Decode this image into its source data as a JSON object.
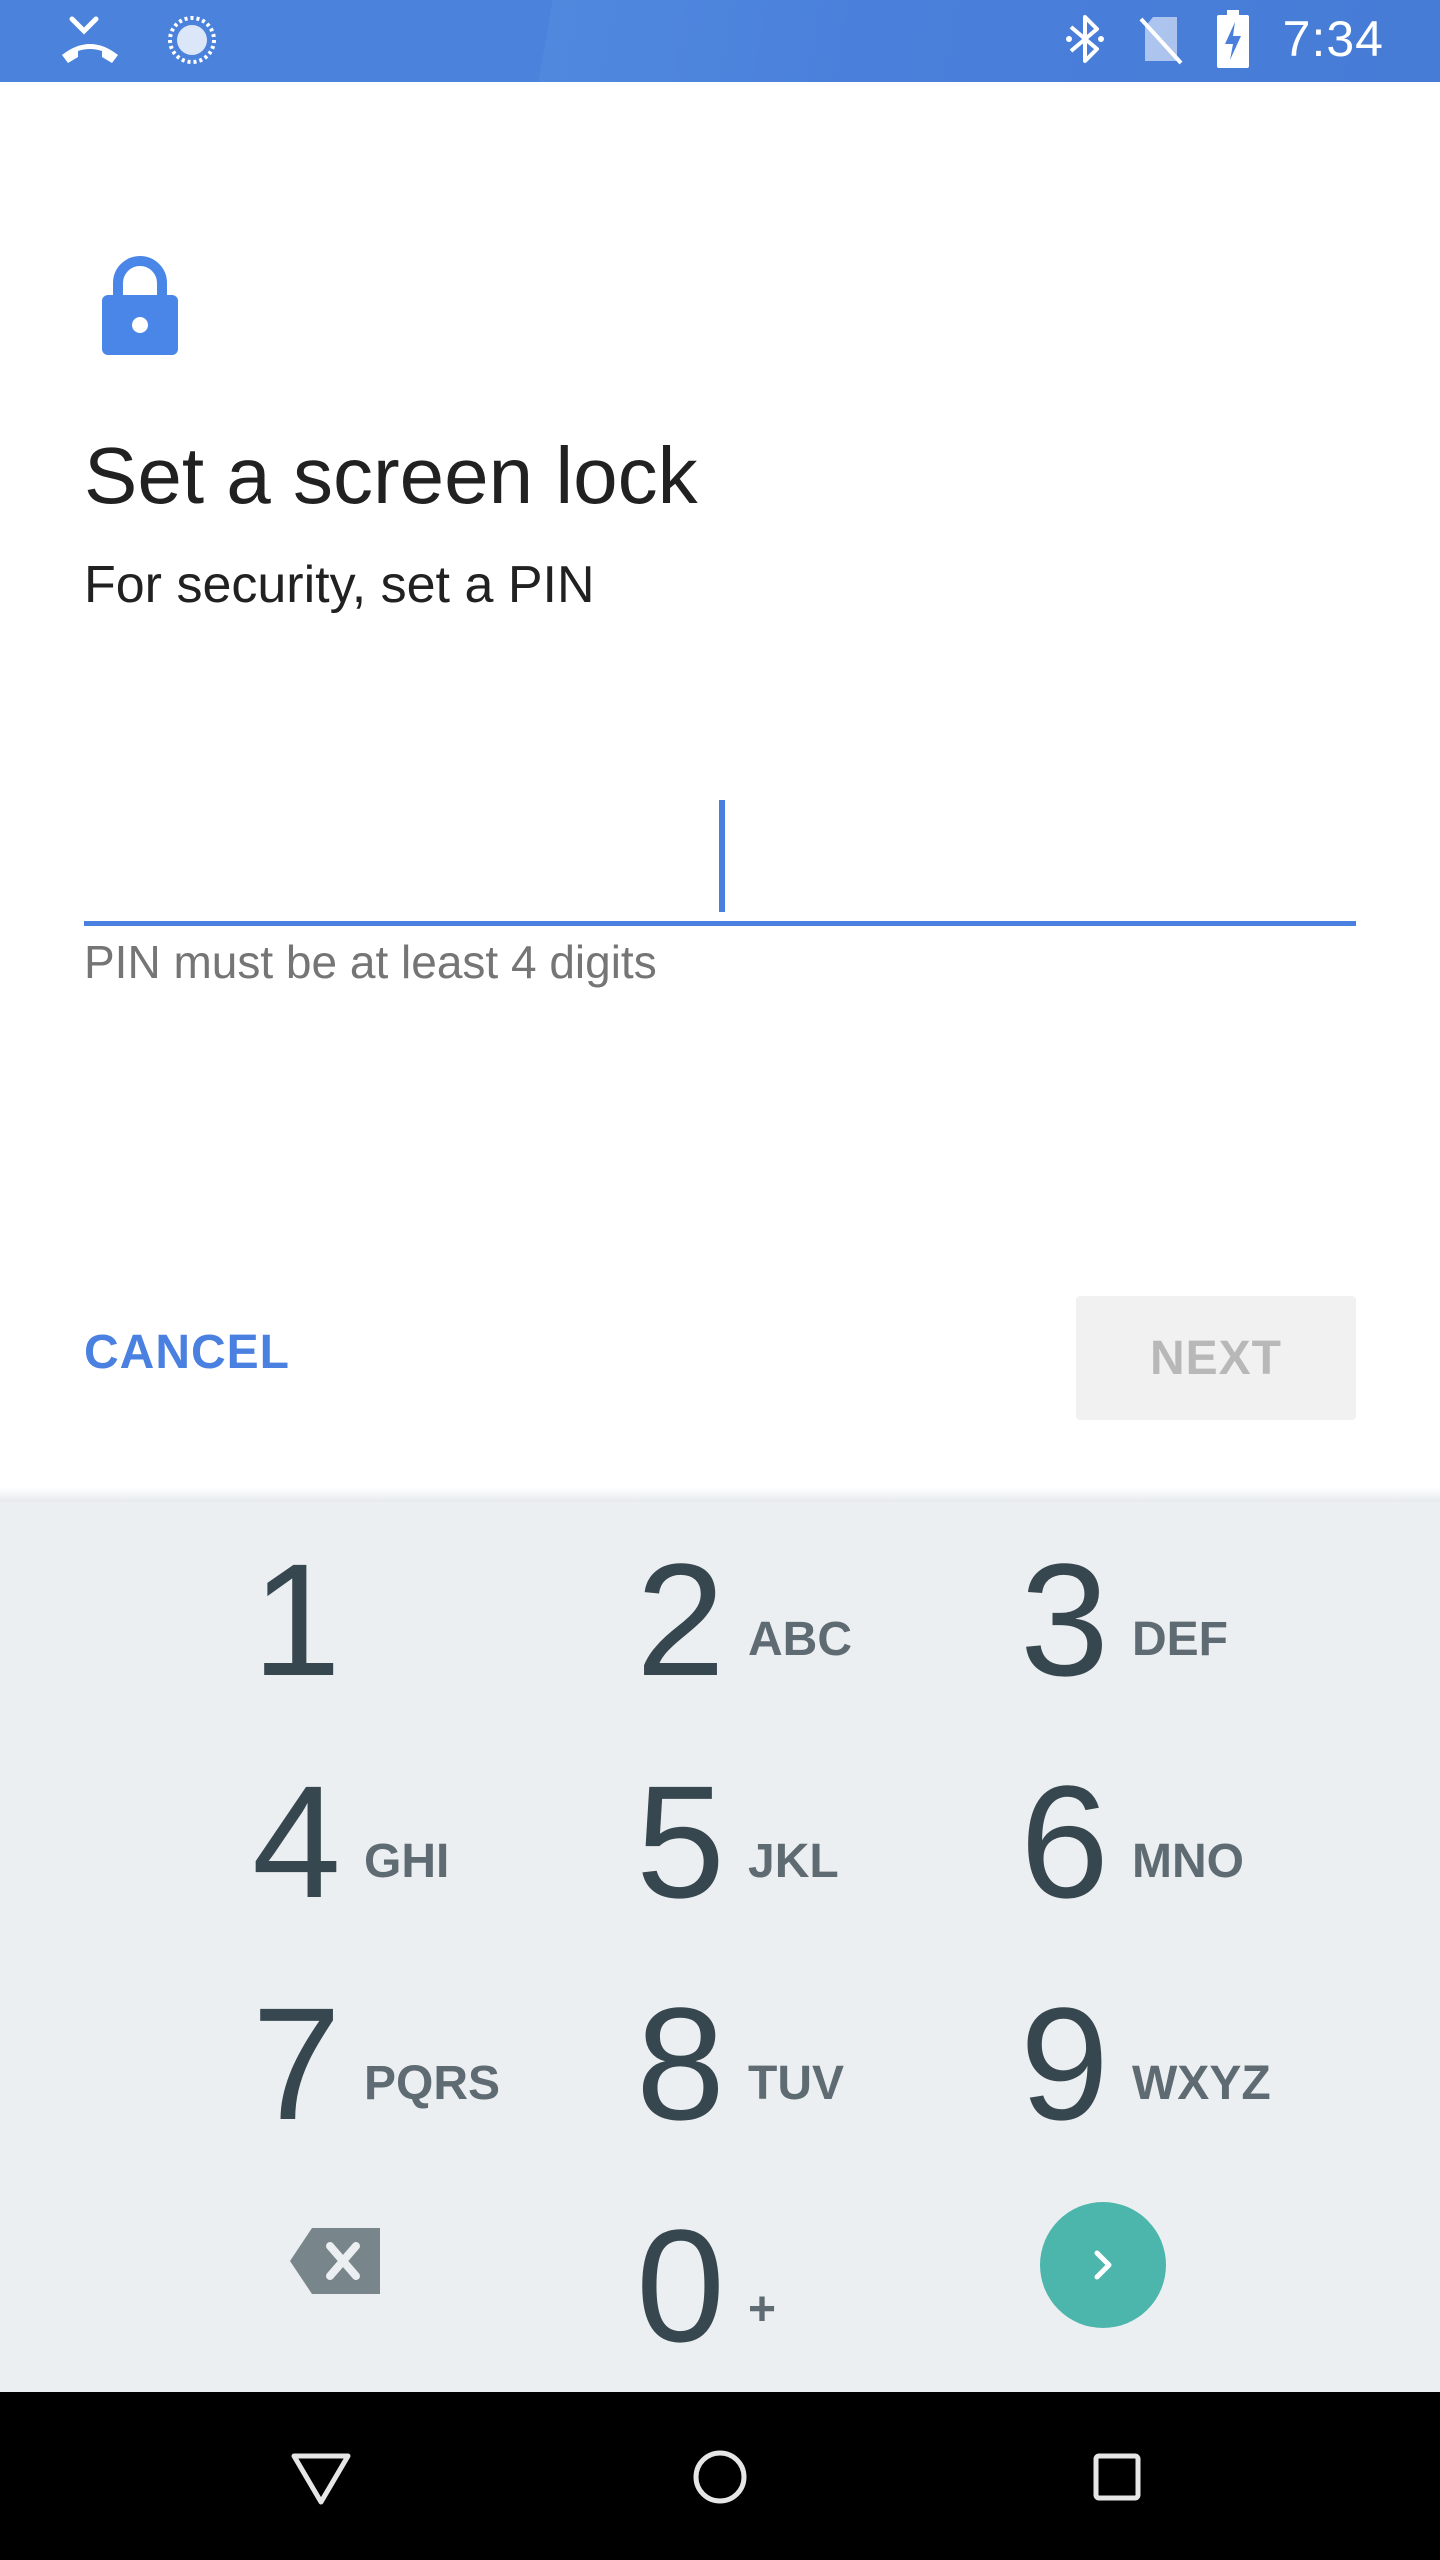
{
  "status_bar": {
    "time": "7:34"
  },
  "screen": {
    "title": "Set a screen lock",
    "subtitle": "For security, set a PIN",
    "pin_value": "",
    "helper_text": "PIN must be at least 4 digits"
  },
  "actions": {
    "cancel_label": "CANCEL",
    "next_label": "NEXT"
  },
  "keypad": {
    "keys": [
      {
        "digit": "1",
        "letters": ""
      },
      {
        "digit": "2",
        "letters": "ABC"
      },
      {
        "digit": "3",
        "letters": "DEF"
      },
      {
        "digit": "4",
        "letters": "GHI"
      },
      {
        "digit": "5",
        "letters": "JKL"
      },
      {
        "digit": "6",
        "letters": "MNO"
      },
      {
        "digit": "7",
        "letters": "PQRS"
      },
      {
        "digit": "8",
        "letters": "TUV"
      },
      {
        "digit": "9",
        "letters": "WXYZ"
      },
      {
        "digit": "0",
        "letters": "+"
      }
    ]
  },
  "icons": {
    "status": [
      "missed-call-icon",
      "sync-icon",
      "bluetooth-icon",
      "no-sim-icon",
      "battery-charging-icon"
    ],
    "lock": "lock-icon",
    "delete": "backspace-icon",
    "go": "chevron-right-icon",
    "nav": [
      "back-icon",
      "home-icon",
      "recents-icon"
    ]
  },
  "colors": {
    "accent": "#4a80e0",
    "keypad_bg": "#eceff1",
    "go_button": "#4db6ac",
    "status_bar": "#4a80db"
  }
}
